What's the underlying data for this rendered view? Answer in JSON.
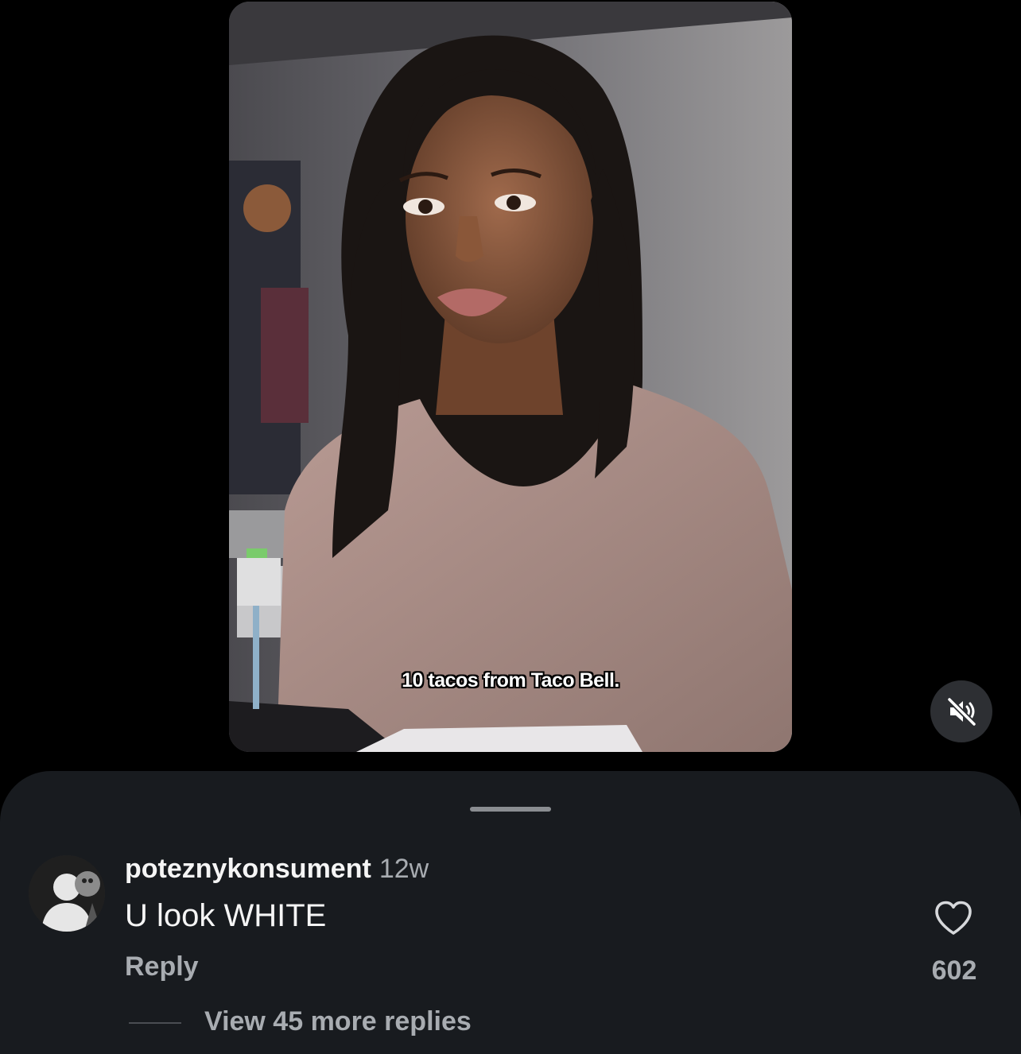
{
  "video": {
    "caption": "10 tacos from Taco Bell."
  },
  "controls": {
    "mute_icon": "muted-speaker-icon"
  },
  "comment": {
    "username": "poteznykonsument",
    "timestamp": "12w",
    "text": "U look WHITE",
    "reply_label": "Reply",
    "like_icon": "heart-icon",
    "like_count": "602",
    "view_replies_label": "View 45 more replies"
  },
  "colors": {
    "background": "#000000",
    "sheet": "#181b1f",
    "secondary_text": "#a8acb1",
    "primary_text": "#f5f5f5"
  }
}
